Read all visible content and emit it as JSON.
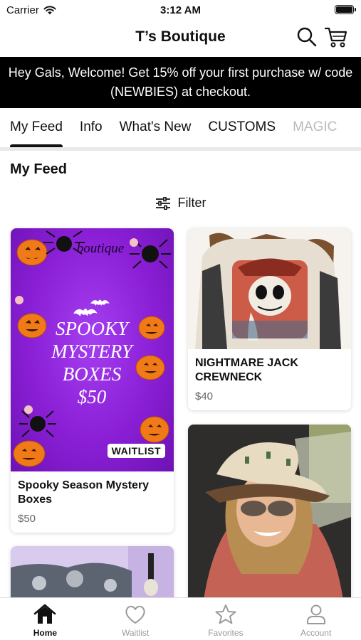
{
  "status_bar": {
    "carrier": "Carrier",
    "time": "3:12 AM"
  },
  "header": {
    "title": "T’s Boutique",
    "icons": [
      "search-icon",
      "cart-icon"
    ]
  },
  "banner": {
    "text": "Hey Gals, Welcome! Get 15% off your first purchase w/ code (NEWBIES) at checkout."
  },
  "tabs": [
    "My Feed",
    "Info",
    "What's New",
    "CUSTOMS",
    "MAGIC"
  ],
  "section": {
    "title": "My Feed",
    "filter_label": "Filter"
  },
  "products": [
    {
      "name": "Spooky Season Mystery Boxes",
      "price": "$50",
      "badge": "WAITLIST",
      "image_text": {
        "brand": "boutique",
        "lines": [
          "SPOOKY",
          "MYSTERY",
          "BOXES",
          "$50"
        ]
      }
    },
    {
      "name": "NIGHTMARE JACK CREWNECK",
      "price": "$40"
    }
  ],
  "bottom_nav": [
    {
      "label": "Home",
      "icon": "home-icon"
    },
    {
      "label": "Waitlist",
      "icon": "heart-icon"
    },
    {
      "label": "Favorites",
      "icon": "star-icon"
    },
    {
      "label": "Account",
      "icon": "account-icon"
    }
  ],
  "colors": {
    "banner_bg": "#000000",
    "promo_purple": "#8a1fd6",
    "active": "#111111",
    "inactive": "#9a9a9a"
  }
}
